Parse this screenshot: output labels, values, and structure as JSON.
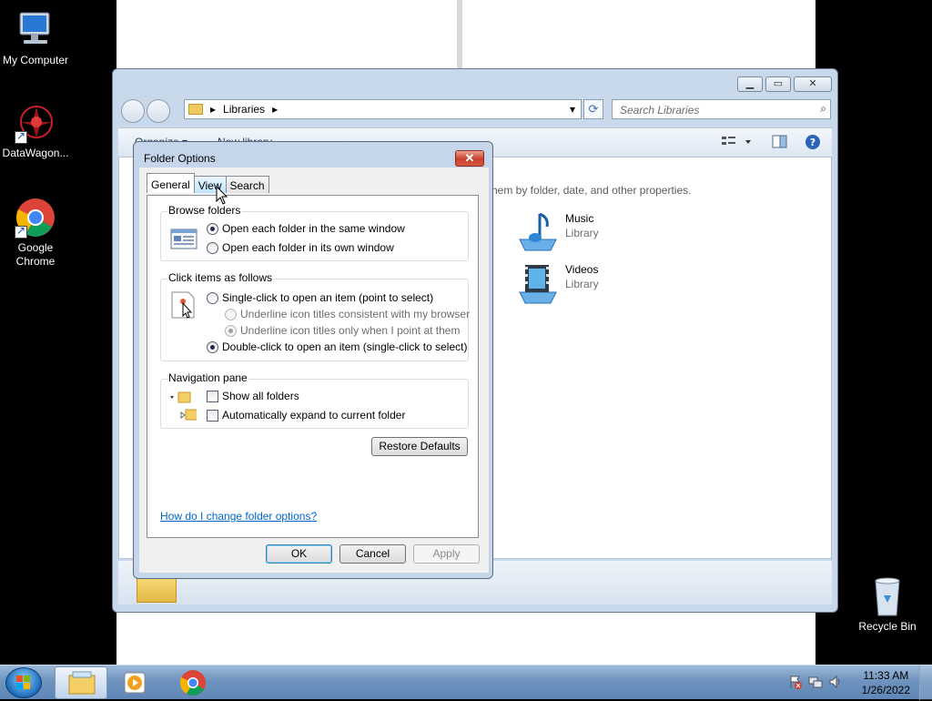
{
  "desktop": {
    "icons": [
      {
        "label": "My Computer",
        "icon": "computer-icon"
      },
      {
        "label": "DataWagon...",
        "icon": "datawagon-icon"
      },
      {
        "label": "Google Chrome",
        "icon": "chrome-icon"
      },
      {
        "label": "Recycle Bin",
        "icon": "recycle-bin-icon"
      }
    ]
  },
  "explorer": {
    "address": "Libraries",
    "search_placeholder": "Search Libraries",
    "toolbar": {
      "organize": "Organize ▾",
      "new_library": "New library"
    },
    "hint": "hem by folder, date, and other properties.",
    "libraries": [
      {
        "name": "Music",
        "type": "Library"
      },
      {
        "name": "Videos",
        "type": "Library"
      }
    ]
  },
  "dialog": {
    "title": "Folder Options",
    "close": "✕",
    "tabs": [
      "General",
      "View",
      "Search"
    ],
    "active_tab": "General",
    "browse_folders": {
      "title": "Browse folders",
      "options": [
        "Open each folder in the same window",
        "Open each folder in its own window"
      ],
      "selected": 0
    },
    "click_items": {
      "title": "Click items as follows",
      "options": [
        "Single-click to open an item (point to select)",
        "Underline icon titles consistent with my browser",
        "Underline icon titles only when I point at them",
        "Double-click to open an item (single-click to select)"
      ],
      "selected": 3
    },
    "navigation_pane": {
      "title": "Navigation pane",
      "options": [
        "Show all folders",
        "Automatically expand to current folder"
      ]
    },
    "restore_defaults": "Restore Defaults",
    "help_link": "How do I change folder options?",
    "buttons": {
      "ok": "OK",
      "cancel": "Cancel",
      "apply": "Apply"
    }
  },
  "taskbar": {
    "time": "11:33 AM",
    "date": "1/26/2022"
  }
}
